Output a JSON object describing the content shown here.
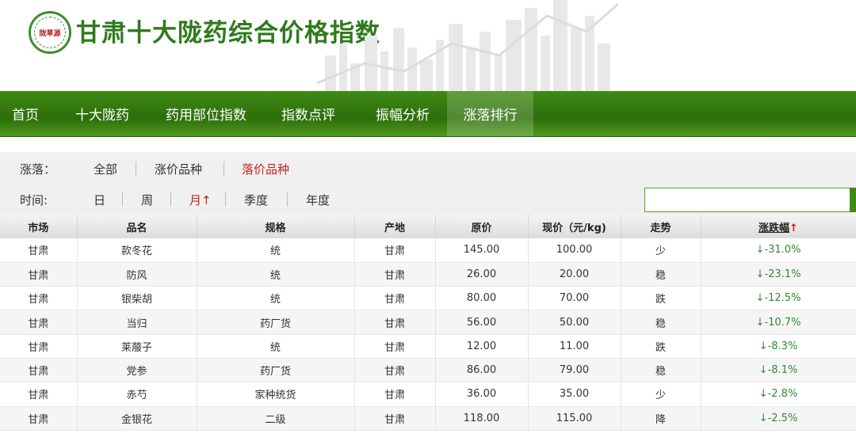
{
  "header": {
    "logo_text": "陇草源",
    "site_title": "甘肃十大陇药综合价格指数"
  },
  "nav": {
    "items": [
      {
        "label": "首页"
      },
      {
        "label": "十大陇药"
      },
      {
        "label": "药用部位指数"
      },
      {
        "label": "指数点评"
      },
      {
        "label": "振幅分析"
      },
      {
        "label": "涨落排行",
        "active": true
      }
    ]
  },
  "filters": {
    "change_label": "涨落：",
    "change_options": [
      "全部",
      "涨价品种",
      "落价品种"
    ],
    "change_selected": "落价品种",
    "time_label": "时间:",
    "time_options": [
      "日",
      "周",
      "月",
      "季度",
      "年度"
    ],
    "time_selected": "月",
    "time_selected_arrow": "↑",
    "search_value": ""
  },
  "table": {
    "headers": [
      "市场",
      "品名",
      "规格",
      "产地",
      "原价",
      "现价（元/kg)",
      "走势",
      "涨跌幅"
    ],
    "sort_arrow": "↑",
    "rows": [
      [
        "甘肃",
        "款冬花",
        "统",
        "甘肃",
        "145.00",
        "100.00",
        "少",
        "↓-31.0%"
      ],
      [
        "甘肃",
        "防风",
        "统",
        "甘肃",
        "26.00",
        "20.00",
        "稳",
        "↓-23.1%"
      ],
      [
        "甘肃",
        "银柴胡",
        "统",
        "甘肃",
        "80.00",
        "70.00",
        "跌",
        "↓-12.5%"
      ],
      [
        "甘肃",
        "当归",
        "药厂货",
        "甘肃",
        "56.00",
        "50.00",
        "稳",
        "↓-10.7%"
      ],
      [
        "甘肃",
        "莱菔子",
        "统",
        "甘肃",
        "12.00",
        "11.00",
        "跌",
        "↓-8.3%"
      ],
      [
        "甘肃",
        "党参",
        "药厂货",
        "甘肃",
        "86.00",
        "79.00",
        "稳",
        "↓-8.1%"
      ],
      [
        "甘肃",
        "赤芍",
        "家种统货",
        "甘肃",
        "36.00",
        "35.00",
        "少",
        "↓-2.8%"
      ],
      [
        "甘肃",
        "金银花",
        "二级",
        "甘肃",
        "118.00",
        "115.00",
        "降",
        "↓-2.5%"
      ]
    ]
  },
  "colors": {
    "brand_green": "#2f7a1c",
    "selected_red": "#c8211f",
    "change_green": "#2e8b2e"
  }
}
